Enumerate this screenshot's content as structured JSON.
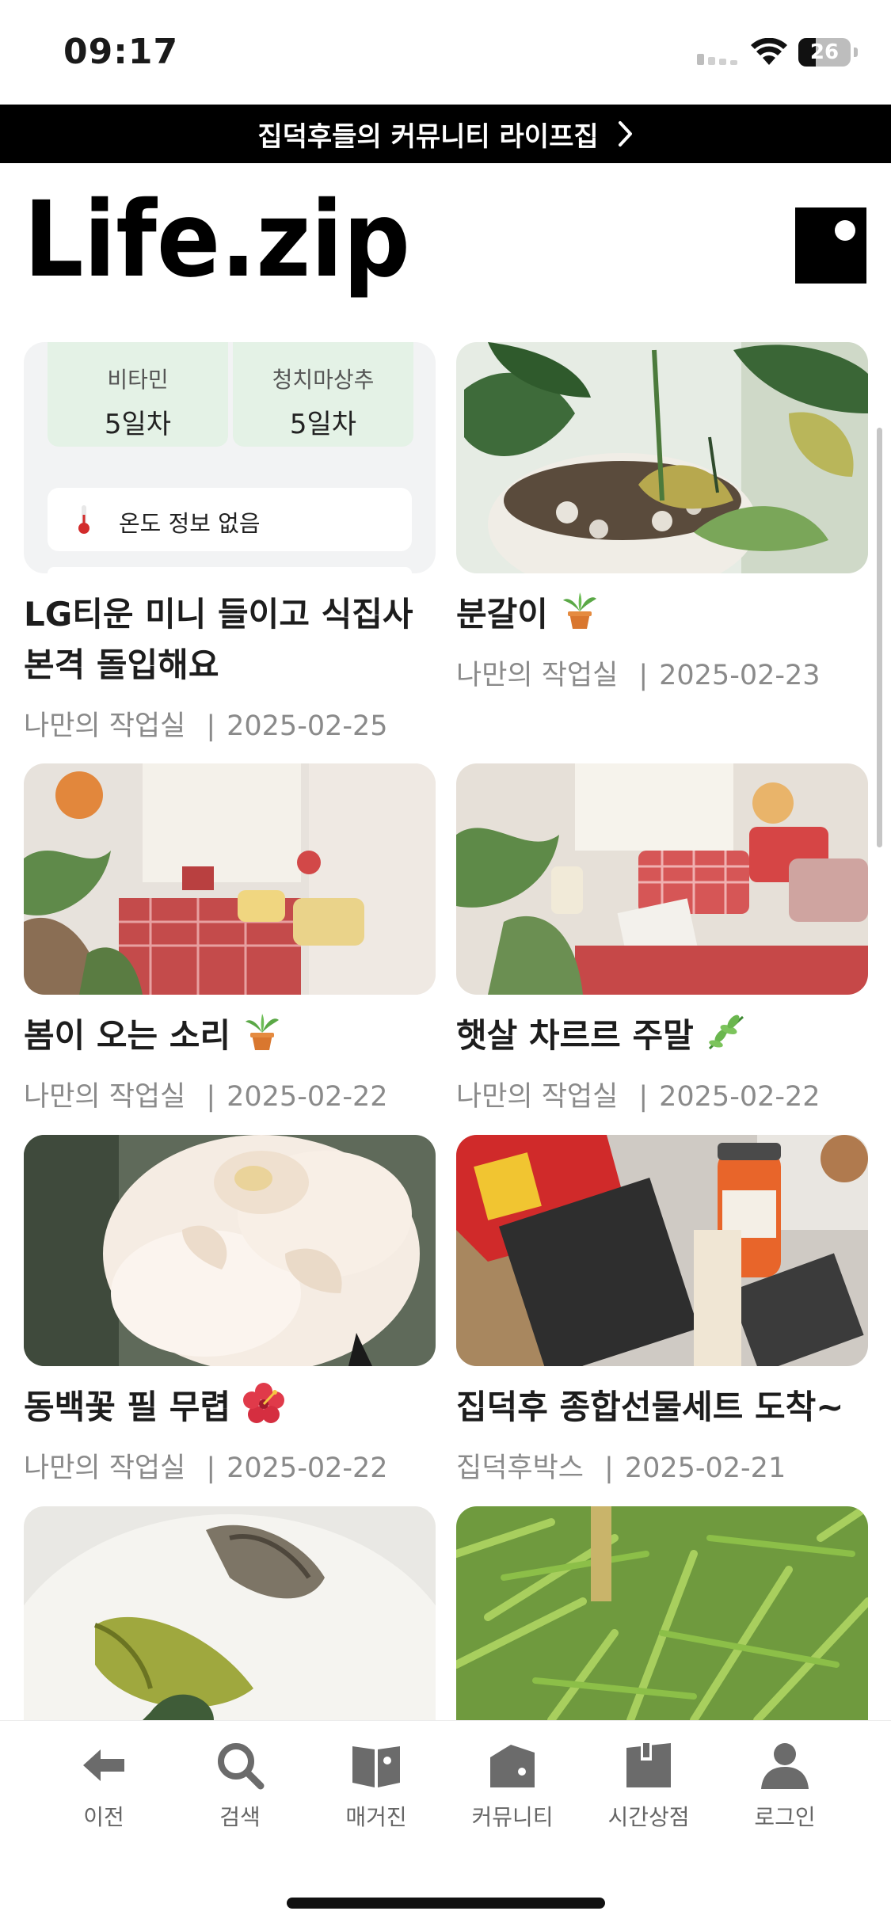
{
  "status_bar": {
    "time": "09:17",
    "battery": "26"
  },
  "banner": {
    "text": "집덕후들의 커뮤니티 라이프집",
    "icon": "chevron-right-icon"
  },
  "header": {
    "logo": "Life.zip"
  },
  "widget": {
    "chips": [
      {
        "label": "비타민",
        "value": "5일차"
      },
      {
        "label": "청치마상추",
        "value": "5일차"
      }
    ],
    "temperature": "온도 정보 없음"
  },
  "posts": [
    {
      "title_lines": [
        "LG티운 미니 들이고 식집사",
        "본격 돌입해요"
      ],
      "category": "나만의 작업실",
      "date": "2025-02-25"
    },
    {
      "title_lines": [
        "분갈이"
      ],
      "category": "나만의 작업실",
      "date": "2025-02-23"
    },
    {
      "title_lines": [
        "봄이 오는 소리"
      ],
      "category": "나만의 작업실",
      "date": "2025-02-22"
    },
    {
      "title_lines": [
        "햇살 차르르 주말"
      ],
      "category": "나만의 작업실",
      "date": "2025-02-22"
    },
    {
      "title_lines": [
        "동백꽃 필 무렵"
      ],
      "category": "나만의 작업실",
      "date": "2025-02-22"
    },
    {
      "title_lines": [
        "집덕후 종합선물세트 도착~"
      ],
      "category": "집덕후박스",
      "date": "2025-02-21"
    }
  ],
  "nav": [
    {
      "label": "이전",
      "icon": "arrow-left-icon"
    },
    {
      "label": "검색",
      "icon": "search-icon"
    },
    {
      "label": "매거진",
      "icon": "magazine-icon"
    },
    {
      "label": "커뮤니티",
      "icon": "community-icon"
    },
    {
      "label": "시간상점",
      "icon": "shop-icon"
    },
    {
      "label": "로그인",
      "icon": "user-icon"
    }
  ],
  "colors": {
    "banner_bg": "#000000",
    "chip_bg": "#e4f2e6",
    "meta_text": "#8a8a8a"
  }
}
